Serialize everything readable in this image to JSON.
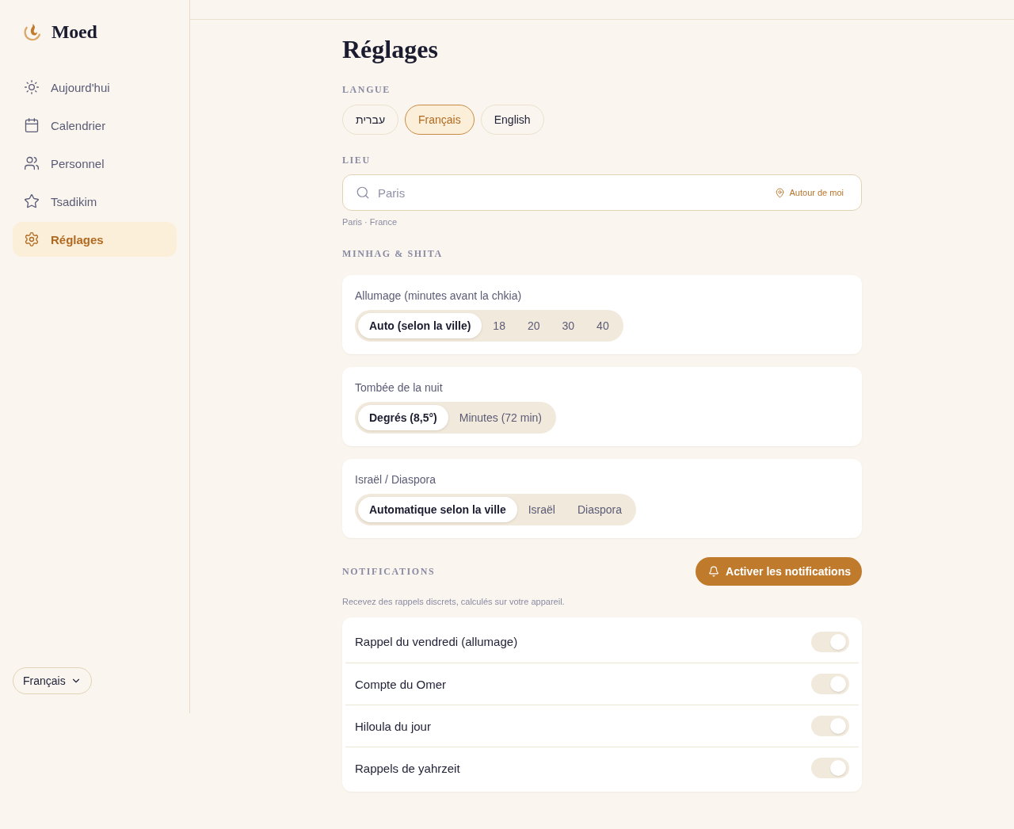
{
  "sidebar": {
    "brand": "Moed",
    "nav": [
      {
        "label": "Aujourd'hui",
        "selected": false
      },
      {
        "label": "Calendrier",
        "selected": false
      },
      {
        "label": "Personnel",
        "selected": false
      },
      {
        "label": "Tsadikim",
        "selected": false
      },
      {
        "label": "Réglages",
        "selected": true
      }
    ],
    "language_select": {
      "value": "Français"
    }
  },
  "page": {
    "title": "Réglages"
  },
  "language": {
    "heading": "LANGUE",
    "options": [
      {
        "label": "עברית",
        "selected": false
      },
      {
        "label": "Français",
        "selected": true
      },
      {
        "label": "English",
        "selected": false
      }
    ]
  },
  "location": {
    "heading": "LIEU",
    "search": {
      "placeholder": "Paris"
    },
    "locate_button": "Autour de moi",
    "selected_place": "Paris · France"
  },
  "minhag": {
    "heading": "MINHAG & SHITA",
    "settings": [
      {
        "label": "Allumage (minutes avant la chkia)",
        "options": [
          {
            "label": "Auto (selon la ville)",
            "selected": true
          },
          {
            "label": "18",
            "selected": false
          },
          {
            "label": "20",
            "selected": false
          },
          {
            "label": "30",
            "selected": false
          },
          {
            "label": "40",
            "selected": false
          }
        ]
      },
      {
        "label": "Tombée de la nuit",
        "options": [
          {
            "label": "Degrés (8,5°)",
            "selected": true
          },
          {
            "label": "Minutes (72 min)",
            "selected": false
          }
        ]
      },
      {
        "label": "Israël / Diaspora",
        "options": [
          {
            "label": "Automatique selon la ville",
            "selected": true
          },
          {
            "label": "Israël",
            "selected": false
          },
          {
            "label": "Diaspora",
            "selected": false
          }
        ]
      }
    ]
  },
  "notifications": {
    "heading": "NOTIFICATIONS",
    "enable_button": "Activer les notifications",
    "description": "Recevez des rappels discrets, calculés sur votre appareil.",
    "toggles": [
      {
        "label": "Rappel du vendredi (allumage)",
        "on": true,
        "disabled": true
      },
      {
        "label": "Compte du Omer",
        "on": true,
        "disabled": true
      },
      {
        "label": "Hiloula du jour",
        "on": true,
        "disabled": true
      },
      {
        "label": "Rappels de yahrzeit",
        "on": true,
        "disabled": true
      }
    ]
  }
}
